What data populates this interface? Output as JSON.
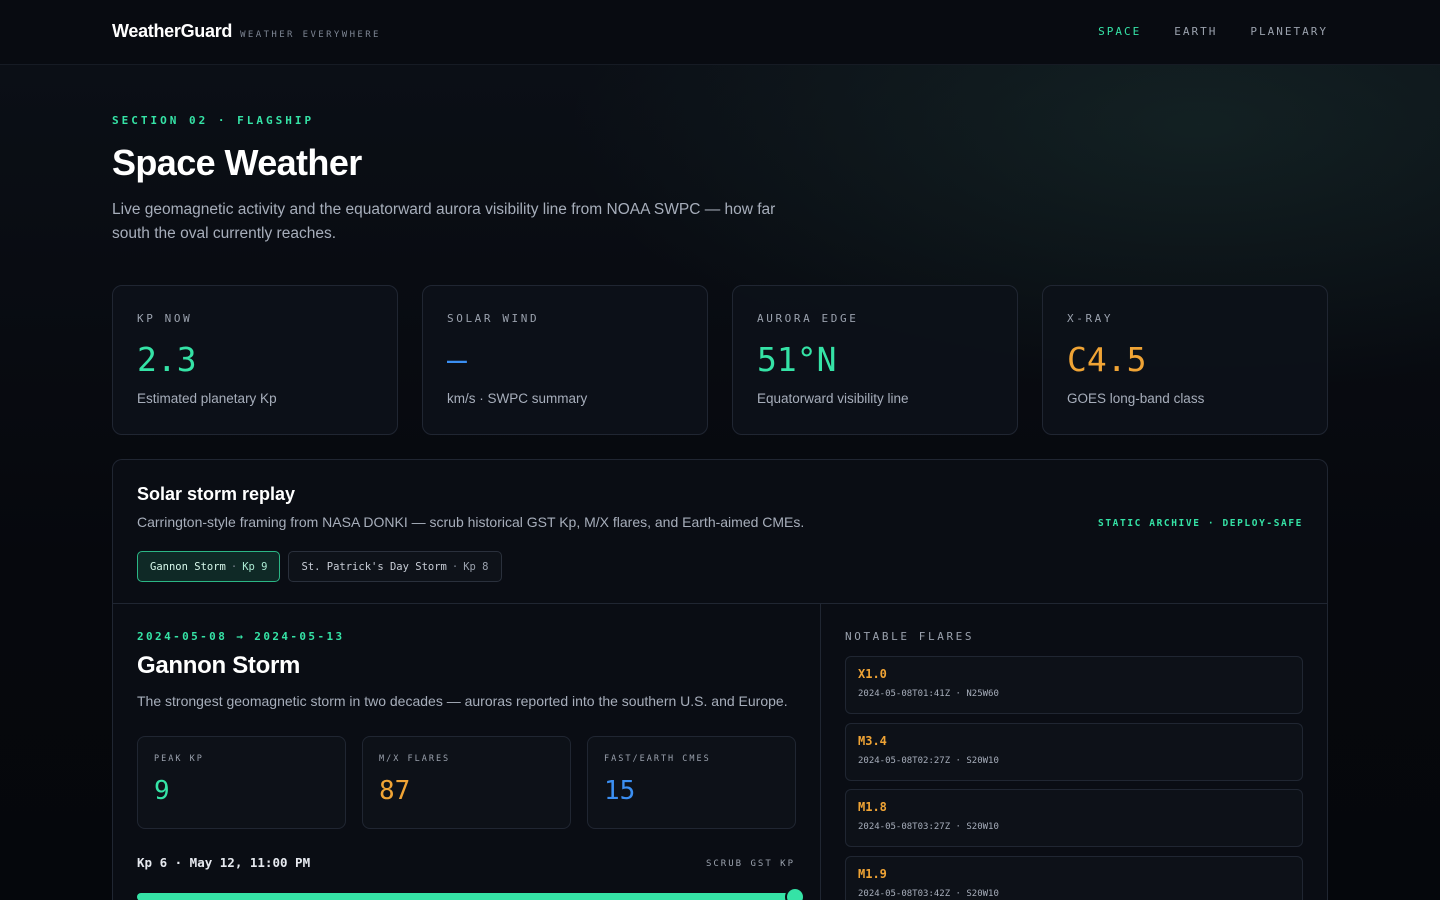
{
  "brand": {
    "name": "WeatherGuard",
    "tagline": "WEATHER EVERYWHERE"
  },
  "nav": [
    {
      "label": "SPACE",
      "active": true
    },
    {
      "label": "EARTH",
      "active": false
    },
    {
      "label": "PLANETARY",
      "active": false
    }
  ],
  "hero": {
    "eyebrow": "SECTION 02 · FLAGSHIP",
    "title": "Space Weather",
    "description": "Live geomagnetic activity and the equatorward aurora visibility line from NOAA SWPC — how far south the oval currently reaches."
  },
  "stats": [
    {
      "label": "KP NOW",
      "value": "2.3",
      "sub": "Estimated planetary Kp",
      "color": "#35e3a6"
    },
    {
      "label": "SOLAR WIND",
      "value": "—",
      "sub": "km/s · SWPC summary",
      "color": "#3b8ff2"
    },
    {
      "label": "AURORA EDGE",
      "value": "51°N",
      "sub": "Equatorward visibility line",
      "color": "#35e3a6"
    },
    {
      "label": "X-RAY",
      "value": "C4.5",
      "sub": "GOES long-band class",
      "color": "#f0a435"
    }
  ],
  "replay": {
    "title": "Solar storm replay",
    "description": "Carrington-style framing from NASA DONKI — scrub historical GST Kp, M/X flares, and Earth-aimed CMEs.",
    "badge": "STATIC ARCHIVE · DEPLOY-SAFE",
    "tabs": [
      {
        "name": "Gannon Storm",
        "sep": "·",
        "kp": "Kp 9",
        "active": true
      },
      {
        "name": "St. Patrick's Day Storm",
        "sep": "·",
        "kp": "Kp 8",
        "active": false
      }
    ],
    "selected": {
      "date_range": "2024-05-08 → 2024-05-13",
      "name": "Gannon Storm",
      "description": "The strongest geomagnetic storm in two decades — auroras reported into the southern U.S. and Europe.",
      "metrics": [
        {
          "label": "PEAK KP",
          "value": "9",
          "color": "#35e3a6"
        },
        {
          "label": "M/X FLARES",
          "value": "87",
          "color": "#f0a435"
        },
        {
          "label": "FAST/EARTH CMES",
          "value": "15",
          "color": "#3b8ff2"
        }
      ]
    },
    "scrub": {
      "readout": "Kp 6 · May 12, 11:00 PM",
      "label": "SCRUB GST KP",
      "progress": 1.0
    },
    "flares_heading": "NOTABLE FLARES",
    "flares": [
      {
        "class": "X1.0",
        "meta": "2024-05-08T01:41Z · N25W60"
      },
      {
        "class": "M3.4",
        "meta": "2024-05-08T02:27Z · S20W10"
      },
      {
        "class": "M1.8",
        "meta": "2024-05-08T03:27Z · S20W10"
      },
      {
        "class": "M1.9",
        "meta": "2024-05-08T03:42Z · S20W10"
      }
    ]
  }
}
